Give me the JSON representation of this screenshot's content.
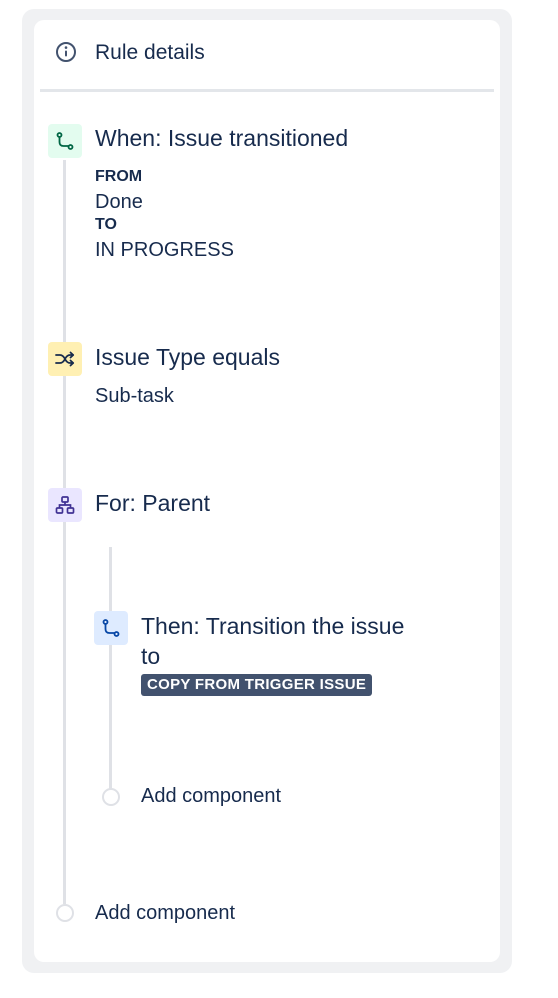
{
  "header": {
    "title": "Rule details",
    "icon": "info-icon"
  },
  "trigger": {
    "icon": "transition-icon",
    "icon_bg": "#e3fcef",
    "icon_color": "#006644",
    "title": "When: Issue transitioned",
    "from_label": "FROM",
    "from_value": "Done",
    "to_label": "TO",
    "to_value": "IN PROGRESS"
  },
  "condition": {
    "icon": "shuffle-icon",
    "icon_bg": "#fff0b3",
    "icon_color": "#172b4d",
    "title": "Issue Type equals",
    "value": "Sub-task"
  },
  "branch": {
    "icon": "hierarchy-icon",
    "icon_bg": "#eae6ff",
    "icon_color": "#403294",
    "title": "For: Parent"
  },
  "action": {
    "icon": "transition-icon",
    "icon_bg": "#deebff",
    "icon_color": "#0747a6",
    "title_line1": "Then: Transition the issue",
    "title_line2": "to",
    "lozenge": "COPY FROM TRIGGER ISSUE",
    "lozenge_color": "#42526e"
  },
  "nested_add": {
    "label": "Add component"
  },
  "main_add": {
    "label": "Add component"
  }
}
